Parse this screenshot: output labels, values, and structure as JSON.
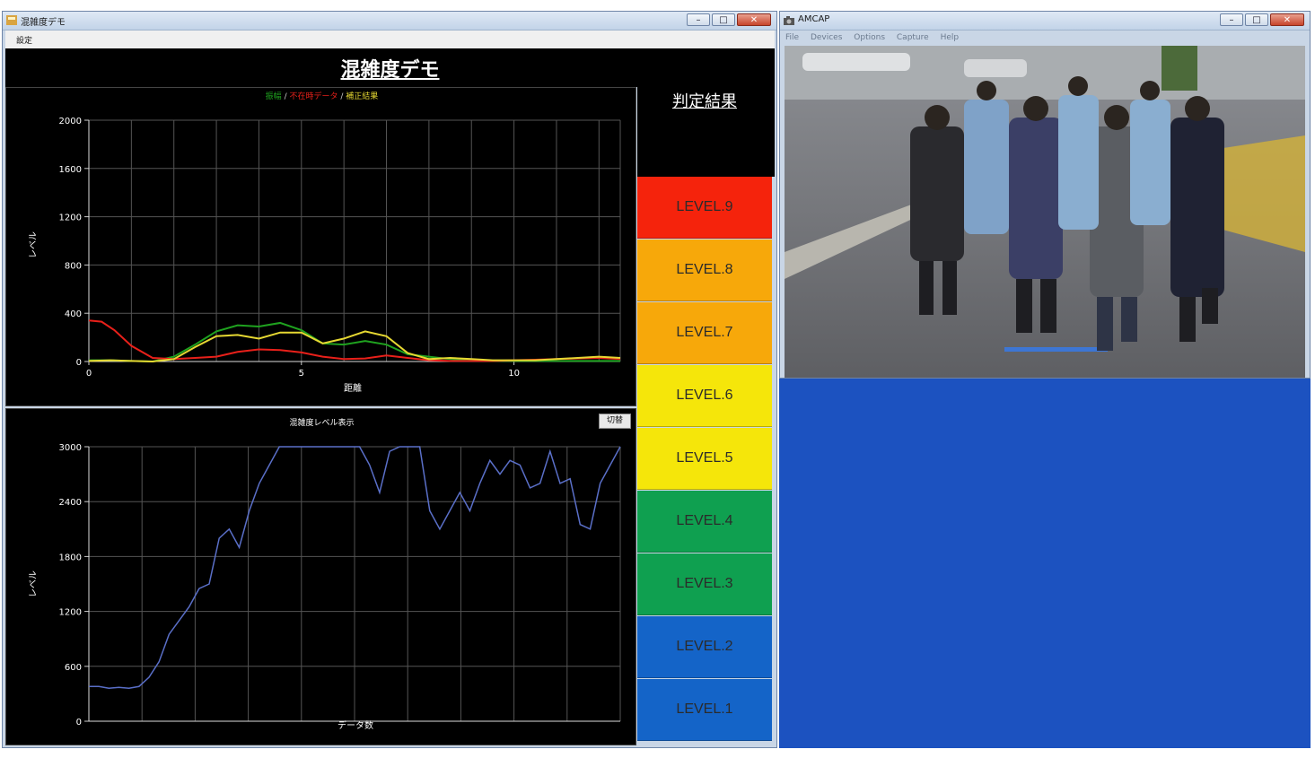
{
  "left_window": {
    "title": "混雑度デモ",
    "menu": [
      "設定"
    ],
    "app_heading": "混雑度デモ",
    "top_chart": {
      "legend": [
        "振幅",
        "/",
        "不在時データ",
        "/",
        "補正結果"
      ],
      "ylabel": "レベル",
      "xlabel": "距離",
      "yticks": [
        "2000",
        "1600",
        "1200",
        "800",
        "400",
        "0"
      ],
      "xticks": [
        "0",
        "5",
        "10"
      ]
    },
    "bottom_chart": {
      "title": "混雑度レベル表示",
      "toggle_label": "切替",
      "ylabel": "レベル",
      "xlabel": "データ数",
      "yticks": [
        "3000",
        "2400",
        "1800",
        "1200",
        "600",
        "0"
      ]
    },
    "result_heading": "判定結果",
    "levels": [
      "LEVEL.9",
      "LEVEL.8",
      "LEVEL.7",
      "LEVEL.6",
      "LEVEL.5",
      "LEVEL.4",
      "LEVEL.3",
      "LEVEL.2",
      "LEVEL.1"
    ],
    "level_colors": [
      "#f5230c",
      "#f7a80a",
      "#f7a80a",
      "#f5e60a",
      "#f5e60a",
      "#0fa050",
      "#0fa050",
      "#1464c8",
      "#1464c8"
    ]
  },
  "right_window": {
    "title": "AMCAP",
    "menu": [
      "File",
      "Devices",
      "Options",
      "Capture",
      "Help"
    ],
    "background_color": "#1c52c0"
  },
  "chart_data": [
    {
      "type": "line",
      "xlabel": "距離",
      "ylabel": "レベル",
      "xlim": [
        0,
        12.5
      ],
      "ylim": [
        0,
        2000
      ],
      "series": [
        {
          "name": "振幅",
          "color": "#1fa21f",
          "x": [
            0,
            0.5,
            1,
            1.5,
            2,
            2.5,
            3,
            3.5,
            4,
            4.5,
            5,
            5.5,
            6,
            6.5,
            7,
            7.5,
            8,
            8.5,
            9,
            9.5,
            10,
            10.5,
            11,
            11.5,
            12,
            12.5
          ],
          "y": [
            10,
            10,
            5,
            0,
            40,
            140,
            250,
            300,
            290,
            320,
            260,
            150,
            140,
            170,
            140,
            60,
            40,
            20,
            10,
            5,
            5,
            5,
            5,
            5,
            5,
            5
          ]
        },
        {
          "name": "不在時データ",
          "color": "#e8201a",
          "x": [
            0,
            0.3,
            0.6,
            1,
            1.5,
            2,
            2.5,
            3,
            3.5,
            4,
            4.5,
            5,
            5.5,
            6,
            6.5,
            7,
            7.5,
            8,
            8.5,
            9,
            9.5,
            10,
            10.5,
            11,
            11.5,
            12,
            12.5
          ],
          "y": [
            340,
            330,
            260,
            130,
            30,
            20,
            30,
            40,
            80,
            100,
            95,
            75,
            40,
            20,
            25,
            50,
            30,
            10,
            5,
            5,
            5,
            10,
            15,
            20,
            25,
            30,
            20
          ]
        },
        {
          "name": "補正結果",
          "color": "#e6d832",
          "x": [
            0,
            0.5,
            1,
            1.5,
            2,
            2.5,
            3,
            3.5,
            4,
            4.5,
            5,
            5.5,
            6,
            6.5,
            7,
            7.5,
            8,
            8.5,
            9,
            9.5,
            10,
            10.5,
            11,
            11.5,
            12,
            12.5
          ],
          "y": [
            5,
            10,
            5,
            0,
            20,
            120,
            210,
            220,
            190,
            240,
            240,
            150,
            190,
            250,
            210,
            70,
            20,
            30,
            20,
            10,
            10,
            10,
            20,
            30,
            40,
            30
          ]
        }
      ]
    },
    {
      "type": "line",
      "title": "混雑度レベル表示",
      "xlabel": "データ数",
      "ylabel": "レベル",
      "ylim": [
        0,
        3000
      ],
      "series": [
        {
          "color": "#5a6fc8",
          "values": [
            380,
            380,
            360,
            370,
            360,
            380,
            480,
            650,
            950,
            1100,
            1250,
            1450,
            1500,
            2000,
            2100,
            1900,
            2300,
            2600,
            2800,
            3000,
            3000,
            3000,
            3000,
            3000,
            3000,
            3000,
            3000,
            3000,
            2800,
            2500,
            2950,
            3000,
            3000,
            3000,
            2300,
            2100,
            2300,
            2500,
            2300,
            2600,
            2850,
            2700,
            2850,
            2800,
            2550,
            2600,
            2950,
            2600,
            2650,
            2150,
            2100,
            2600,
            2800,
            3000
          ]
        }
      ]
    }
  ]
}
